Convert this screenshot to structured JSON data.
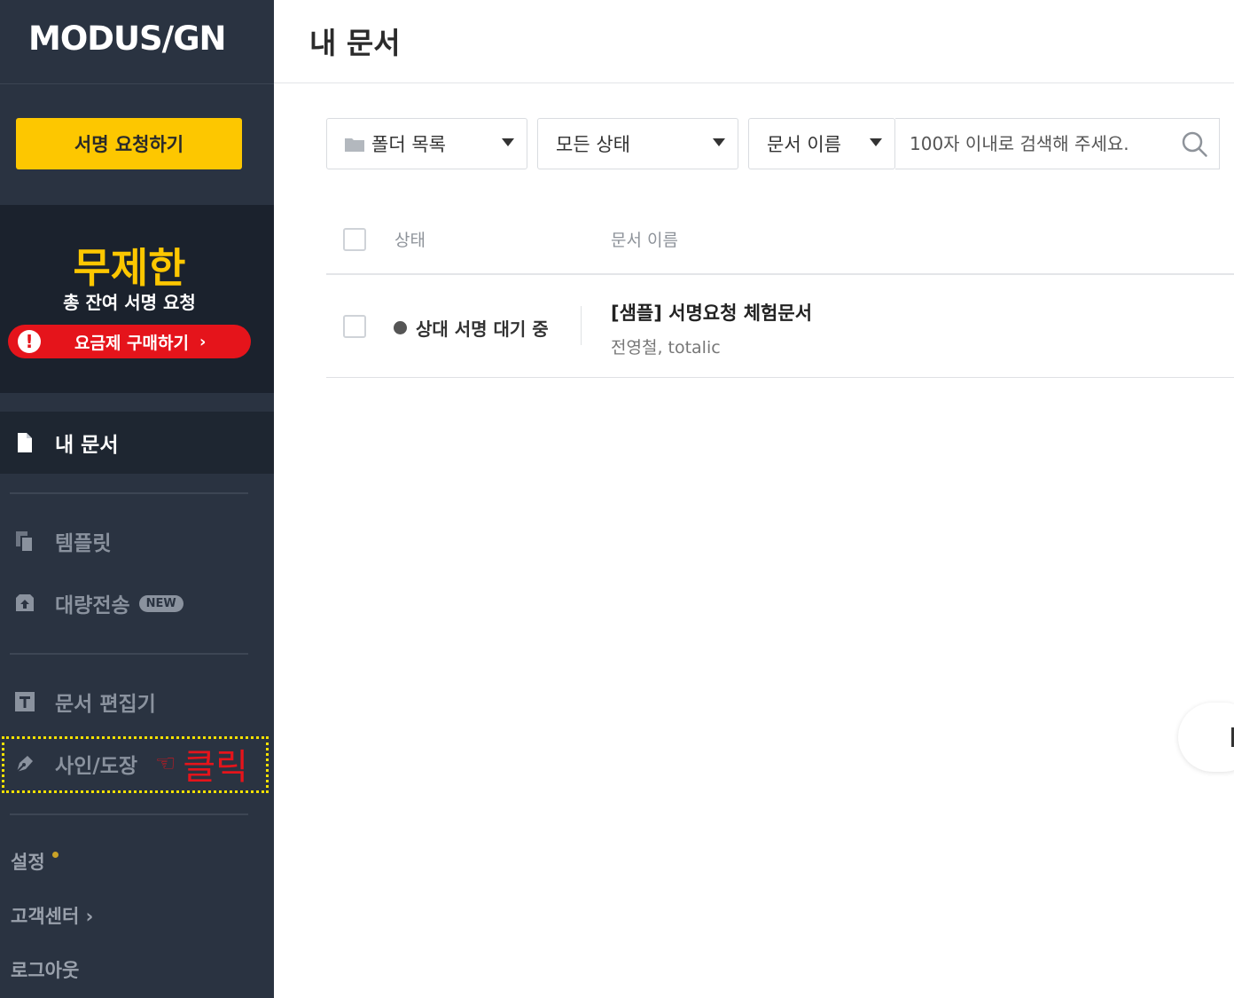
{
  "sidebar": {
    "logo": "MODUS/GN",
    "request_button": "서명 요청하기",
    "plan": {
      "title": "무제한",
      "subtitle": "총 잔여 서명 요청",
      "buy_button": "요금제 구매하기",
      "alert_glyph": "!",
      "chevron": "›"
    },
    "nav": {
      "my_docs": "내 문서",
      "template": "템플릿",
      "bulk_send": "대량전송",
      "new_badge": "NEW",
      "doc_editor": "문서 편집기",
      "sign_stamp": "사인/도장"
    },
    "click_hint": {
      "hand": "☜",
      "text": "클릭"
    },
    "links": {
      "settings": "설정",
      "support": "고객센터 ›",
      "logout": "로그아웃"
    }
  },
  "main": {
    "title": "내 문서",
    "filters": {
      "folder": "폴더 목록",
      "status": "모든 상태",
      "field": "문서 이름"
    },
    "search": {
      "placeholder": "100자 이내로 검색해 주세요."
    },
    "table": {
      "headers": [
        "상태",
        "문서 이름"
      ],
      "rows": [
        {
          "status": "상대 서명 대기 중",
          "title": "[샘플] 서명요청 체험문서",
          "users": "전영철, totalic"
        }
      ]
    }
  },
  "colors": {
    "sidebar_bg": "#2a3341",
    "accent_yellow": "#fdc700",
    "alert_red": "#e5141b",
    "highlight_yellow": "#f5e100"
  },
  "icons": [
    "file-icon",
    "template-icon",
    "bulk-send-icon",
    "text-editor-icon",
    "pen-nib-icon",
    "folder-icon",
    "search-icon",
    "caret-down-icon",
    "alert-icon"
  ]
}
